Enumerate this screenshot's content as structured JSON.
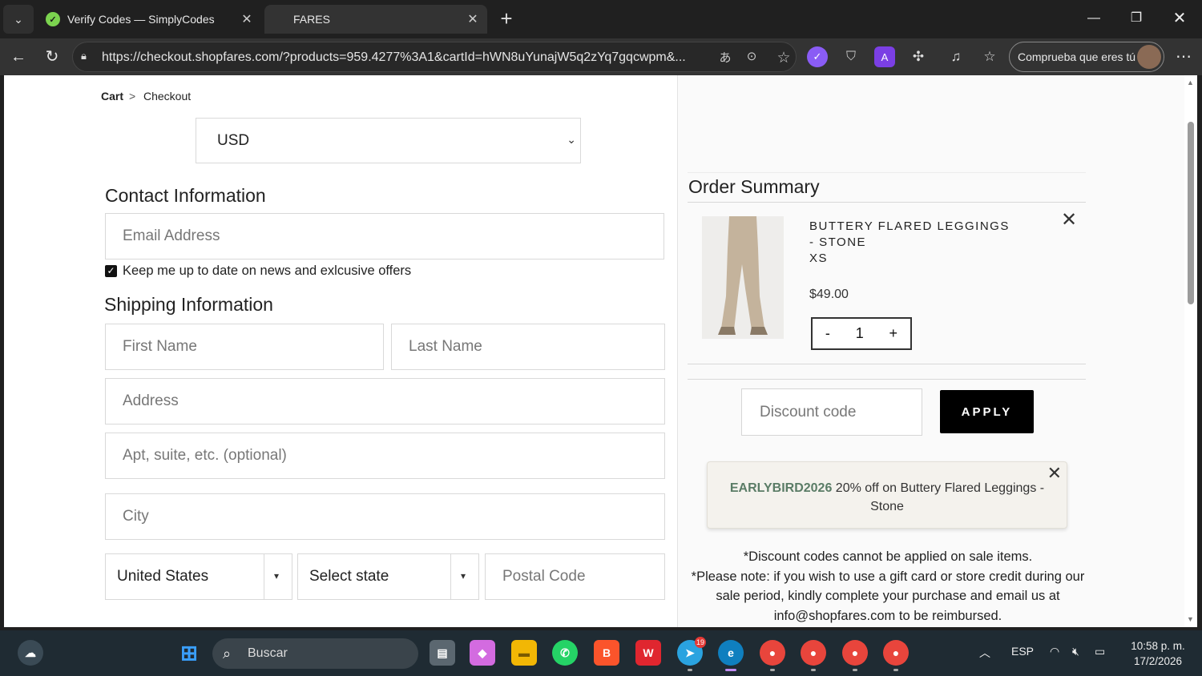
{
  "browser": {
    "tabs": [
      {
        "title": "Verify Codes — SimplyCodes"
      },
      {
        "title": "FARES"
      }
    ],
    "url": "https://checkout.shopfares.com/?products=959.4277%3A1&cartId=hWN8uYunajW5q2zYq7gqcwpm&...",
    "profile_label": "Comprueba que eres tú",
    "accent": "#7b5cff"
  },
  "checkout": {
    "breadcrumb": {
      "cart": "Cart",
      "sep": ">",
      "checkout": "Checkout"
    },
    "currency": "USD",
    "contact_title": "Contact Information",
    "email_placeholder": "Email Address",
    "newsletter_checked": true,
    "newsletter_label": "Keep me up to date on news and exlcusive offers",
    "shipping_title": "Shipping Information",
    "first_name_placeholder": "First Name",
    "last_name_placeholder": "Last Name",
    "address_placeholder": "Address",
    "apt_placeholder": "Apt, suite, etc. (optional)",
    "city_placeholder": "City",
    "country": "United States",
    "state": "Select state",
    "postal_placeholder": "Postal Code"
  },
  "summary": {
    "title": "Order Summary",
    "item": {
      "name": "BUTTERY FLARED LEGGINGS - STONE",
      "size": "XS",
      "price": "$49.00",
      "qty": "1",
      "minus": "-",
      "plus": "+"
    },
    "discount_placeholder": "Discount code",
    "apply_label": "APPLY",
    "promo": {
      "code": "EARLYBIRD2026",
      "text": "20% off on Buttery Flared Leggings - Stone"
    },
    "notes": [
      "*Discount codes cannot be applied on sale items.",
      "*Please note: if you wish to use a gift card or store credit during our sale period, kindly complete your purchase and email us at info@shopfares.com to be reimbursed."
    ]
  },
  "taskbar": {
    "search_label": "Buscar",
    "telegram_badge": "19",
    "language": "ESP",
    "time": "10:58 p. m.",
    "date": "17/2/2026"
  }
}
